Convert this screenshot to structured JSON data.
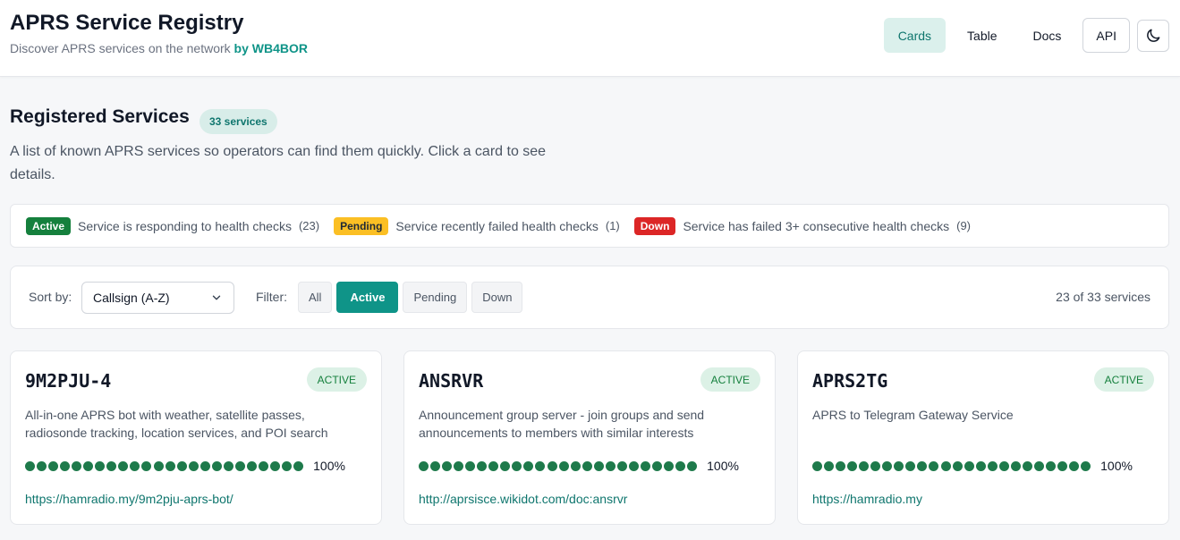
{
  "header": {
    "title": "APRS Service Registry",
    "subtitle": "Discover APRS services on the network",
    "by": "by WB4BOR",
    "nav": {
      "cards": "Cards",
      "table": "Table",
      "docs": "Docs",
      "api": "API"
    },
    "theme_icon": "moon-icon"
  },
  "section": {
    "title": "Registered Services",
    "count_badge": "33 services",
    "description": "A list of known APRS services so operators can find them quickly. Click a card to see details."
  },
  "legend": [
    {
      "pill": "Active",
      "text": "Service is responding to health checks",
      "count": "(23)"
    },
    {
      "pill": "Pending",
      "text": "Service recently failed health checks",
      "count": "(1)"
    },
    {
      "pill": "Down",
      "text": "Service has failed 3+ consecutive health checks",
      "count": "(9)"
    }
  ],
  "controls": {
    "sort_label": "Sort by:",
    "sort_value": "Callsign (A-Z)",
    "filter_label": "Filter:",
    "filters": [
      "All",
      "Active",
      "Pending",
      "Down"
    ],
    "selected_filter": "Active",
    "result_count": "23 of 33 services"
  },
  "cards": [
    {
      "callsign": "9M2PJU-4",
      "status": "ACTIVE",
      "description": "All-in-one APRS bot with weather, satellite passes, radiosonde tracking, location services, and POI search",
      "uptime": "100%",
      "url": "https://hamradio.my/9m2pju-aprs-bot/"
    },
    {
      "callsign": "ANSRVR",
      "status": "ACTIVE",
      "description": "Announcement group server - join groups and send announcements to members with similar interests",
      "uptime": "100%",
      "url": "http://aprsisce.wikidot.com/doc:ansrvr"
    },
    {
      "callsign": "APRS2TG",
      "status": "ACTIVE",
      "description": "APRS to Telegram Gateway Service",
      "uptime": "100%",
      "url": "https://hamradio.my"
    }
  ],
  "colors": {
    "accent": "#0f9488",
    "active": "#15803d",
    "pending": "#fbbf24",
    "down": "#dc2626",
    "uptime_dot": "#1e7a4b"
  }
}
